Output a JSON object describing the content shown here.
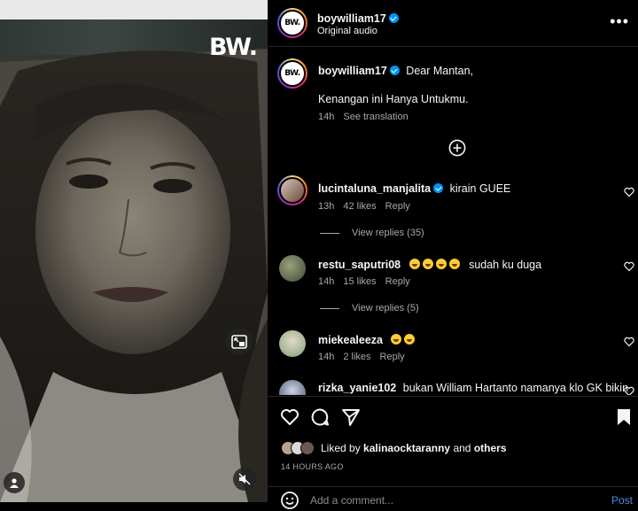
{
  "media": {
    "logo_text": "BW.",
    "icons": [
      "picture-in-picture-icon",
      "muted-speaker-icon",
      "user-tag-icon"
    ]
  },
  "post": {
    "author": "boywilliam17",
    "verified": true,
    "audio_label": "Original audio",
    "avatar_text": "BW."
  },
  "caption": {
    "author": "boywilliam17",
    "line1": "Dear Mantan,",
    "line2": "Kenangan ini Hanya Untukmu.",
    "time": "14h",
    "translate_label": "See translation"
  },
  "comments": [
    {
      "username": "lucintaluna_manjalita",
      "verified": true,
      "text": "kirain GUEE",
      "emoji_count": 0,
      "time": "13h",
      "likes": "42 likes",
      "reply_label": "Reply",
      "view_replies": "View replies (35)"
    },
    {
      "username": "restu_saputri08",
      "verified": false,
      "text": "sudah ku duga",
      "emoji_count": 4,
      "time": "14h",
      "likes": "15 likes",
      "reply_label": "Reply",
      "view_replies": "View replies (5)"
    },
    {
      "username": "miekealeeza",
      "verified": false,
      "text": "",
      "emoji_count": 2,
      "time": "14h",
      "likes": "2 likes",
      "reply_label": "Reply",
      "view_replies": ""
    },
    {
      "username": "rizka_yanie102",
      "verified": false,
      "text": "bukan William Hartanto namanya klo GK bikin",
      "emoji_count": 0,
      "time": "",
      "likes": "",
      "reply_label": "",
      "view_replies": ""
    }
  ],
  "likes_summary": {
    "prefix": "Liked by",
    "user": "kalinaocktaranny",
    "conjunction": "and",
    "others": "others"
  },
  "time_ago": "14 HOURS AGO",
  "comment_box": {
    "placeholder": "Add a comment...",
    "post_label": "Post"
  },
  "colors": {
    "background": "#000000",
    "accent_blue": "#0095f6",
    "post_link": "#4a90e2",
    "muted_text": "#a8a8a8"
  }
}
